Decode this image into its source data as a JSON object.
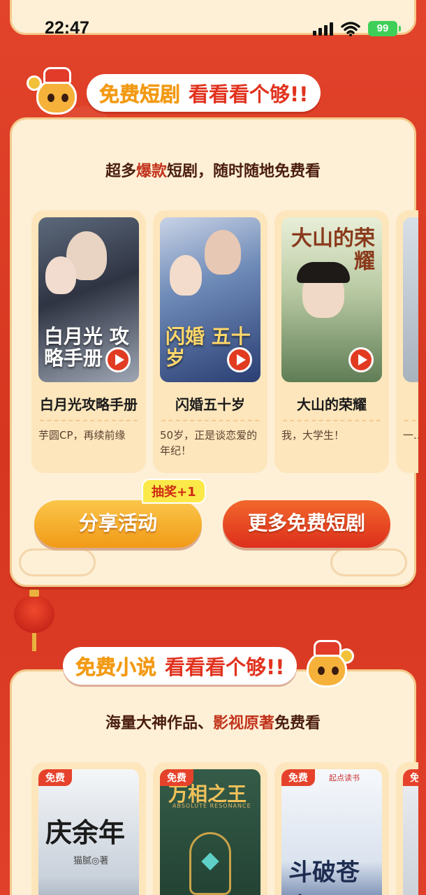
{
  "status_bar": {
    "time": "22:47",
    "battery": "99",
    "icons": [
      "signal-icon",
      "wifi-icon",
      "battery-icon"
    ]
  },
  "colors": {
    "page_background": "#d93a26",
    "card_background": "#fdf0d6",
    "accent_orange": "#f29a14",
    "accent_red": "#e1331f"
  },
  "drama_section": {
    "banner_part1": "免费短剧",
    "banner_part2": "看看看个够!!",
    "subtitle_pre": "超多",
    "subtitle_hl": "爆款",
    "subtitle_post": "短剧，随时随地免费看",
    "items": [
      {
        "title": "白月光攻略手册",
        "poster_text": "白月光 攻略手册",
        "desc": "芋圆CP，再续前缘"
      },
      {
        "title": "闪婚五十岁",
        "poster_text": "闪婚 五十岁",
        "desc": "50岁，正是谈恋爱的年纪！"
      },
      {
        "title": "大山的荣耀",
        "poster_text": "大山的荣耀",
        "desc": "我，大学生！"
      },
      {
        "title": "",
        "poster_text": "",
        "desc": "一... 不..."
      }
    ],
    "share_button": "分享活动",
    "lottery_badge": "抽奖+1",
    "more_button": "更多免费短剧"
  },
  "novel_section": {
    "banner_part1": "免费小说",
    "banner_part2": "看看看个够!!",
    "subtitle_pre": "海量大神作品、",
    "subtitle_hl": "影视原著",
    "subtitle_post": "免费看",
    "free_tag": "免费",
    "items": [
      {
        "cover_title": "庆余年",
        "author": "猫腻◎著"
      },
      {
        "cover_title": "万相之王",
        "cover_sub": "ABSOLUTE RESONANCE"
      },
      {
        "cover_title": "斗破苍穹",
        "publisher": "起点读书"
      },
      {
        "cover_title": ""
      }
    ]
  }
}
